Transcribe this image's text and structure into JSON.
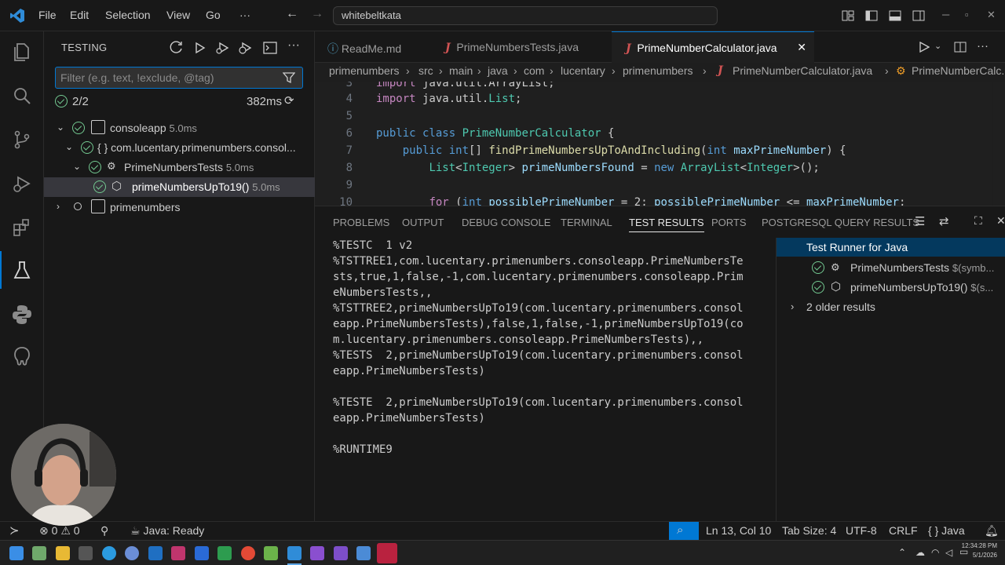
{
  "titlebar": {
    "menus": [
      "File",
      "Edit",
      "Selection",
      "View",
      "Go",
      "···"
    ],
    "search_value": "whitebeltkata"
  },
  "sidebar": {
    "title": "TESTING",
    "filter_placeholder": "Filter (e.g. text, !exclude, @tag)",
    "summary_count": "2/2",
    "summary_time": "382ms",
    "tree": [
      {
        "label": "consoleapp",
        "duration": "5.0ms"
      },
      {
        "label": "{ } com.lucentary.primenumbers.consol..."
      },
      {
        "label": "PrimeNumbersTests",
        "duration": "5.0ms"
      },
      {
        "label": "primeNumbersUpTo19()",
        "duration": "5.0ms"
      },
      {
        "label": "primenumbers"
      }
    ]
  },
  "tabs": [
    {
      "label": "ReadMe.md"
    },
    {
      "label": "PrimeNumbersTests.java"
    },
    {
      "label": "PrimeNumberCalculator.java"
    }
  ],
  "breadcrumb": [
    "primenumbers",
    "src",
    "main",
    "java",
    "com",
    "lucentary",
    "primenumbers",
    "PrimeNumberCalculator.java",
    "PrimeNumberCalc..."
  ],
  "editor": {
    "line_numbers": [
      "3",
      "4",
      "5",
      "6",
      "7",
      "8",
      "9",
      "10"
    ]
  },
  "panel": {
    "tabs": [
      "PROBLEMS",
      "OUTPUT",
      "DEBUG CONSOLE",
      "TERMINAL",
      "TEST RESULTS",
      "PORTS",
      "POSTGRESQL QUERY RESULTS"
    ],
    "output_lines": [
      "%TESTC  1 v2",
      "%TSTTREE1,com.lucentary.primenumbers.consoleapp.PrimeNumbersTe",
      "sts,true,1,false,-1,com.lucentary.primenumbers.consoleapp.Prim",
      "eNumbersTests,,",
      "%TSTTREE2,primeNumbersUpTo19(com.lucentary.primenumbers.consol",
      "eapp.PrimeNumbersTests),false,1,false,-1,primeNumbersUpTo19(co",
      "m.lucentary.primenumbers.consoleapp.PrimeNumbersTests),,",
      "%TESTS  2,primeNumbersUpTo19(com.lucentary.primenumbers.consol",
      "eapp.PrimeNumbersTests)",
      "",
      "%TESTE  2,primeNumbersUpTo19(com.lucentary.primenumbers.consol",
      "eapp.PrimeNumbersTests)",
      "",
      "%RUNTIME9"
    ],
    "results": {
      "title": "Test Runner for Java",
      "items": [
        {
          "label": "PrimeNumbersTests",
          "suffix": "$(symb..."
        },
        {
          "label": "primeNumbersUpTo19()",
          "suffix": "$(s..."
        }
      ],
      "older": "2 older results"
    }
  },
  "statusbar": {
    "errors": "0",
    "warnings": "0",
    "java_status": "Java: Ready",
    "position": "Ln 13, Col 10",
    "tab_size": "Tab Size: 4",
    "encoding": "UTF-8",
    "eol": "CRLF",
    "language": "Java"
  },
  "taskbar": {
    "time": "12:34:28 PM",
    "date": "5/1/2026"
  }
}
